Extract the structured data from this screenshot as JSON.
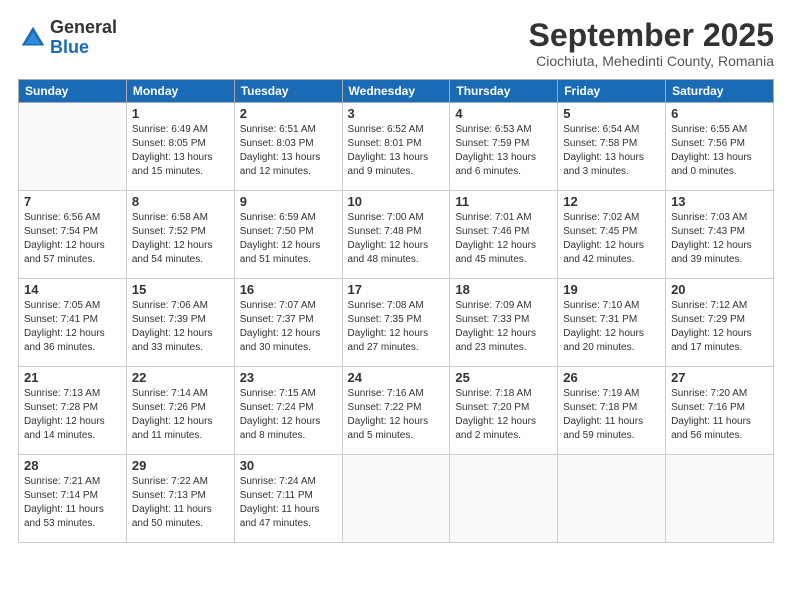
{
  "logo": {
    "general": "General",
    "blue": "Blue"
  },
  "header": {
    "month": "September 2025",
    "location": "Ciochiuta, Mehedinti County, Romania"
  },
  "weekdays": [
    "Sunday",
    "Monday",
    "Tuesday",
    "Wednesday",
    "Thursday",
    "Friday",
    "Saturday"
  ],
  "weeks": [
    [
      {
        "day": "",
        "sunrise": "",
        "sunset": "",
        "daylight": ""
      },
      {
        "day": "1",
        "sunrise": "Sunrise: 6:49 AM",
        "sunset": "Sunset: 8:05 PM",
        "daylight": "Daylight: 13 hours and 15 minutes."
      },
      {
        "day": "2",
        "sunrise": "Sunrise: 6:51 AM",
        "sunset": "Sunset: 8:03 PM",
        "daylight": "Daylight: 13 hours and 12 minutes."
      },
      {
        "day": "3",
        "sunrise": "Sunrise: 6:52 AM",
        "sunset": "Sunset: 8:01 PM",
        "daylight": "Daylight: 13 hours and 9 minutes."
      },
      {
        "day": "4",
        "sunrise": "Sunrise: 6:53 AM",
        "sunset": "Sunset: 7:59 PM",
        "daylight": "Daylight: 13 hours and 6 minutes."
      },
      {
        "day": "5",
        "sunrise": "Sunrise: 6:54 AM",
        "sunset": "Sunset: 7:58 PM",
        "daylight": "Daylight: 13 hours and 3 minutes."
      },
      {
        "day": "6",
        "sunrise": "Sunrise: 6:55 AM",
        "sunset": "Sunset: 7:56 PM",
        "daylight": "Daylight: 13 hours and 0 minutes."
      }
    ],
    [
      {
        "day": "7",
        "sunrise": "Sunrise: 6:56 AM",
        "sunset": "Sunset: 7:54 PM",
        "daylight": "Daylight: 12 hours and 57 minutes."
      },
      {
        "day": "8",
        "sunrise": "Sunrise: 6:58 AM",
        "sunset": "Sunset: 7:52 PM",
        "daylight": "Daylight: 12 hours and 54 minutes."
      },
      {
        "day": "9",
        "sunrise": "Sunrise: 6:59 AM",
        "sunset": "Sunset: 7:50 PM",
        "daylight": "Daylight: 12 hours and 51 minutes."
      },
      {
        "day": "10",
        "sunrise": "Sunrise: 7:00 AM",
        "sunset": "Sunset: 7:48 PM",
        "daylight": "Daylight: 12 hours and 48 minutes."
      },
      {
        "day": "11",
        "sunrise": "Sunrise: 7:01 AM",
        "sunset": "Sunset: 7:46 PM",
        "daylight": "Daylight: 12 hours and 45 minutes."
      },
      {
        "day": "12",
        "sunrise": "Sunrise: 7:02 AM",
        "sunset": "Sunset: 7:45 PM",
        "daylight": "Daylight: 12 hours and 42 minutes."
      },
      {
        "day": "13",
        "sunrise": "Sunrise: 7:03 AM",
        "sunset": "Sunset: 7:43 PM",
        "daylight": "Daylight: 12 hours and 39 minutes."
      }
    ],
    [
      {
        "day": "14",
        "sunrise": "Sunrise: 7:05 AM",
        "sunset": "Sunset: 7:41 PM",
        "daylight": "Daylight: 12 hours and 36 minutes."
      },
      {
        "day": "15",
        "sunrise": "Sunrise: 7:06 AM",
        "sunset": "Sunset: 7:39 PM",
        "daylight": "Daylight: 12 hours and 33 minutes."
      },
      {
        "day": "16",
        "sunrise": "Sunrise: 7:07 AM",
        "sunset": "Sunset: 7:37 PM",
        "daylight": "Daylight: 12 hours and 30 minutes."
      },
      {
        "day": "17",
        "sunrise": "Sunrise: 7:08 AM",
        "sunset": "Sunset: 7:35 PM",
        "daylight": "Daylight: 12 hours and 27 minutes."
      },
      {
        "day": "18",
        "sunrise": "Sunrise: 7:09 AM",
        "sunset": "Sunset: 7:33 PM",
        "daylight": "Daylight: 12 hours and 23 minutes."
      },
      {
        "day": "19",
        "sunrise": "Sunrise: 7:10 AM",
        "sunset": "Sunset: 7:31 PM",
        "daylight": "Daylight: 12 hours and 20 minutes."
      },
      {
        "day": "20",
        "sunrise": "Sunrise: 7:12 AM",
        "sunset": "Sunset: 7:29 PM",
        "daylight": "Daylight: 12 hours and 17 minutes."
      }
    ],
    [
      {
        "day": "21",
        "sunrise": "Sunrise: 7:13 AM",
        "sunset": "Sunset: 7:28 PM",
        "daylight": "Daylight: 12 hours and 14 minutes."
      },
      {
        "day": "22",
        "sunrise": "Sunrise: 7:14 AM",
        "sunset": "Sunset: 7:26 PM",
        "daylight": "Daylight: 12 hours and 11 minutes."
      },
      {
        "day": "23",
        "sunrise": "Sunrise: 7:15 AM",
        "sunset": "Sunset: 7:24 PM",
        "daylight": "Daylight: 12 hours and 8 minutes."
      },
      {
        "day": "24",
        "sunrise": "Sunrise: 7:16 AM",
        "sunset": "Sunset: 7:22 PM",
        "daylight": "Daylight: 12 hours and 5 minutes."
      },
      {
        "day": "25",
        "sunrise": "Sunrise: 7:18 AM",
        "sunset": "Sunset: 7:20 PM",
        "daylight": "Daylight: 12 hours and 2 minutes."
      },
      {
        "day": "26",
        "sunrise": "Sunrise: 7:19 AM",
        "sunset": "Sunset: 7:18 PM",
        "daylight": "Daylight: 11 hours and 59 minutes."
      },
      {
        "day": "27",
        "sunrise": "Sunrise: 7:20 AM",
        "sunset": "Sunset: 7:16 PM",
        "daylight": "Daylight: 11 hours and 56 minutes."
      }
    ],
    [
      {
        "day": "28",
        "sunrise": "Sunrise: 7:21 AM",
        "sunset": "Sunset: 7:14 PM",
        "daylight": "Daylight: 11 hours and 53 minutes."
      },
      {
        "day": "29",
        "sunrise": "Sunrise: 7:22 AM",
        "sunset": "Sunset: 7:13 PM",
        "daylight": "Daylight: 11 hours and 50 minutes."
      },
      {
        "day": "30",
        "sunrise": "Sunrise: 7:24 AM",
        "sunset": "Sunset: 7:11 PM",
        "daylight": "Daylight: 11 hours and 47 minutes."
      },
      {
        "day": "",
        "sunrise": "",
        "sunset": "",
        "daylight": ""
      },
      {
        "day": "",
        "sunrise": "",
        "sunset": "",
        "daylight": ""
      },
      {
        "day": "",
        "sunrise": "",
        "sunset": "",
        "daylight": ""
      },
      {
        "day": "",
        "sunrise": "",
        "sunset": "",
        "daylight": ""
      }
    ]
  ]
}
